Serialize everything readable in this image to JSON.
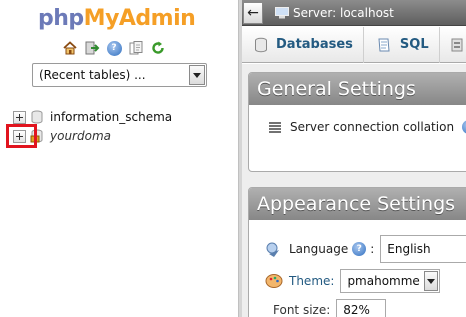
{
  "logo": {
    "part1": "php",
    "part2": "MyAdmin"
  },
  "nav": {
    "icons": [
      "home-icon",
      "logout-icon",
      "help-icon",
      "docs-icon",
      "reload-icon"
    ],
    "recent_tables": {
      "selected": "(Recent tables) ..."
    },
    "databases": [
      {
        "name": "information_schema",
        "italic": false
      },
      {
        "name": "yourdoma",
        "italic": true
      }
    ]
  },
  "topbar": {
    "collapse_glyph": "←",
    "server_label": "Server: localhost"
  },
  "tabs": [
    {
      "label": "Databases",
      "icon": "database-icon"
    },
    {
      "label": "SQL",
      "icon": "sql-icon"
    },
    {
      "label": "",
      "icon": "status-icon"
    }
  ],
  "general_settings": {
    "title": "General Settings",
    "server_connection_collation": "Server connection collation"
  },
  "appearance_settings": {
    "title": "Appearance Settings",
    "language_label": "Language",
    "language_value": "English",
    "theme_label": "Theme:",
    "theme_value": "pmahomme",
    "font_size_label": "Font size:",
    "font_size_value": "82%"
  },
  "colors": {
    "logo_php": "#6c7ab8",
    "logo_admin": "#f59f26",
    "highlight": "#e1141e",
    "link": "#235a81"
  }
}
